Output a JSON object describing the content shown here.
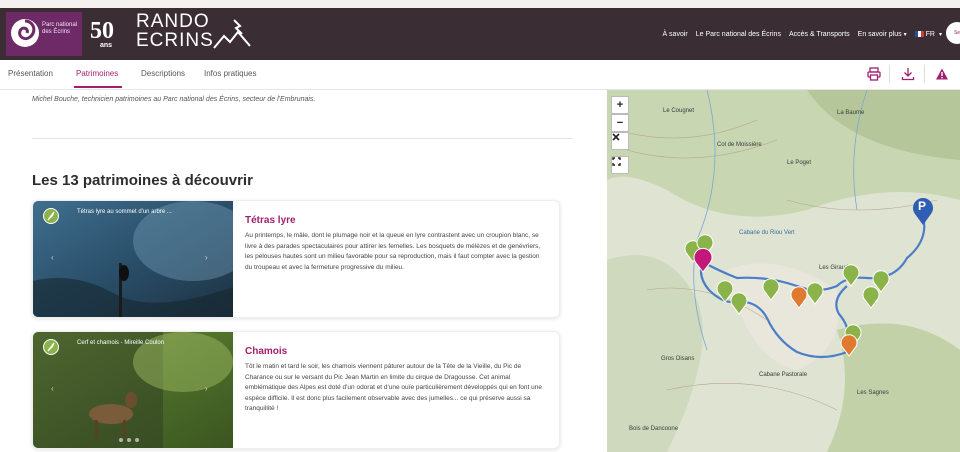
{
  "header": {
    "park_logo_text": "Parc national des Écrins",
    "anniversary_number": "50",
    "anniversary_unit": "ans",
    "brand_line1": "RANDO",
    "brand_line2": "ECRINS",
    "nav": [
      {
        "label": "À savoir"
      },
      {
        "label": "Le Parc national des Écrins"
      },
      {
        "label": "Accès & Transports"
      },
      {
        "label": "En savoir plus"
      },
      {
        "label": "FR"
      }
    ],
    "account_label": "Se"
  },
  "tabs": [
    {
      "label": "Présentation"
    },
    {
      "label": "Patrimoines"
    },
    {
      "label": "Descriptions"
    },
    {
      "label": "Infos pratiques"
    }
  ],
  "tools": {
    "print": "print-icon",
    "download": "download-icon",
    "alert": "warning-icon"
  },
  "content": {
    "credit": "Michel Bouche, technicien patrimoines au Parc national des Écrins, secteur de l'Embrunais.",
    "section_title": "Les 13 patrimoines à découvrir",
    "cards": [
      {
        "caption": "Tétras lyre au sommet d'un arbre ...",
        "title": "Tétras lyre",
        "description": "Au printemps, le mâle, dont le plumage noir et la queue en lyre contrastent avec un croupion blanc, se livre à des parades spectaculaires pour attirer les femelles. Les bosquets de mélèzes et de genévriers, les pelouses hautes sont un milieu favorable pour sa reproduction, mais il faut compter avec la gestion du troupeau et avec la fermeture progressive du milieu."
      },
      {
        "caption": "Cerf et chamois - Mireille Coulon",
        "title": "Chamois",
        "description": "Tôt le matin et tard le soir, les chamois viennent pâturer autour de la Tête de la Vieille, du Pic de Charance ou sur le versant du Pic Jean Martin en limite du cirque de Dragousse. Cet animal emblématique des Alpes est doté d'un odorat et d'une ouïe particulièrement développés qui en font une espèce difficile. Il est donc plus facilement observable avec des jumelles... ce qui préserve aussi sa tranquillité !"
      }
    ]
  },
  "map": {
    "controls": [
      "+",
      "−"
    ],
    "labels": [
      {
        "text": "Col de Moissière"
      },
      {
        "text": "Le Cougnet"
      },
      {
        "text": "La Baume"
      },
      {
        "text": "Le Poget"
      },
      {
        "text": "Les Girauds"
      },
      {
        "text": "Cabane du Riou Vert"
      },
      {
        "text": "Gros Oisans"
      },
      {
        "text": "Cabane Pastorale"
      },
      {
        "text": "Les Sagnes"
      },
      {
        "text": "Bois de Dancoone"
      }
    ],
    "parking_label": "P",
    "colors": {
      "route": "#4a7fc7",
      "marker_green": "#8ab34a",
      "marker_pink": "#c2187a",
      "marker_orange": "#e07a2f",
      "parking": "#2f5fb3"
    }
  }
}
